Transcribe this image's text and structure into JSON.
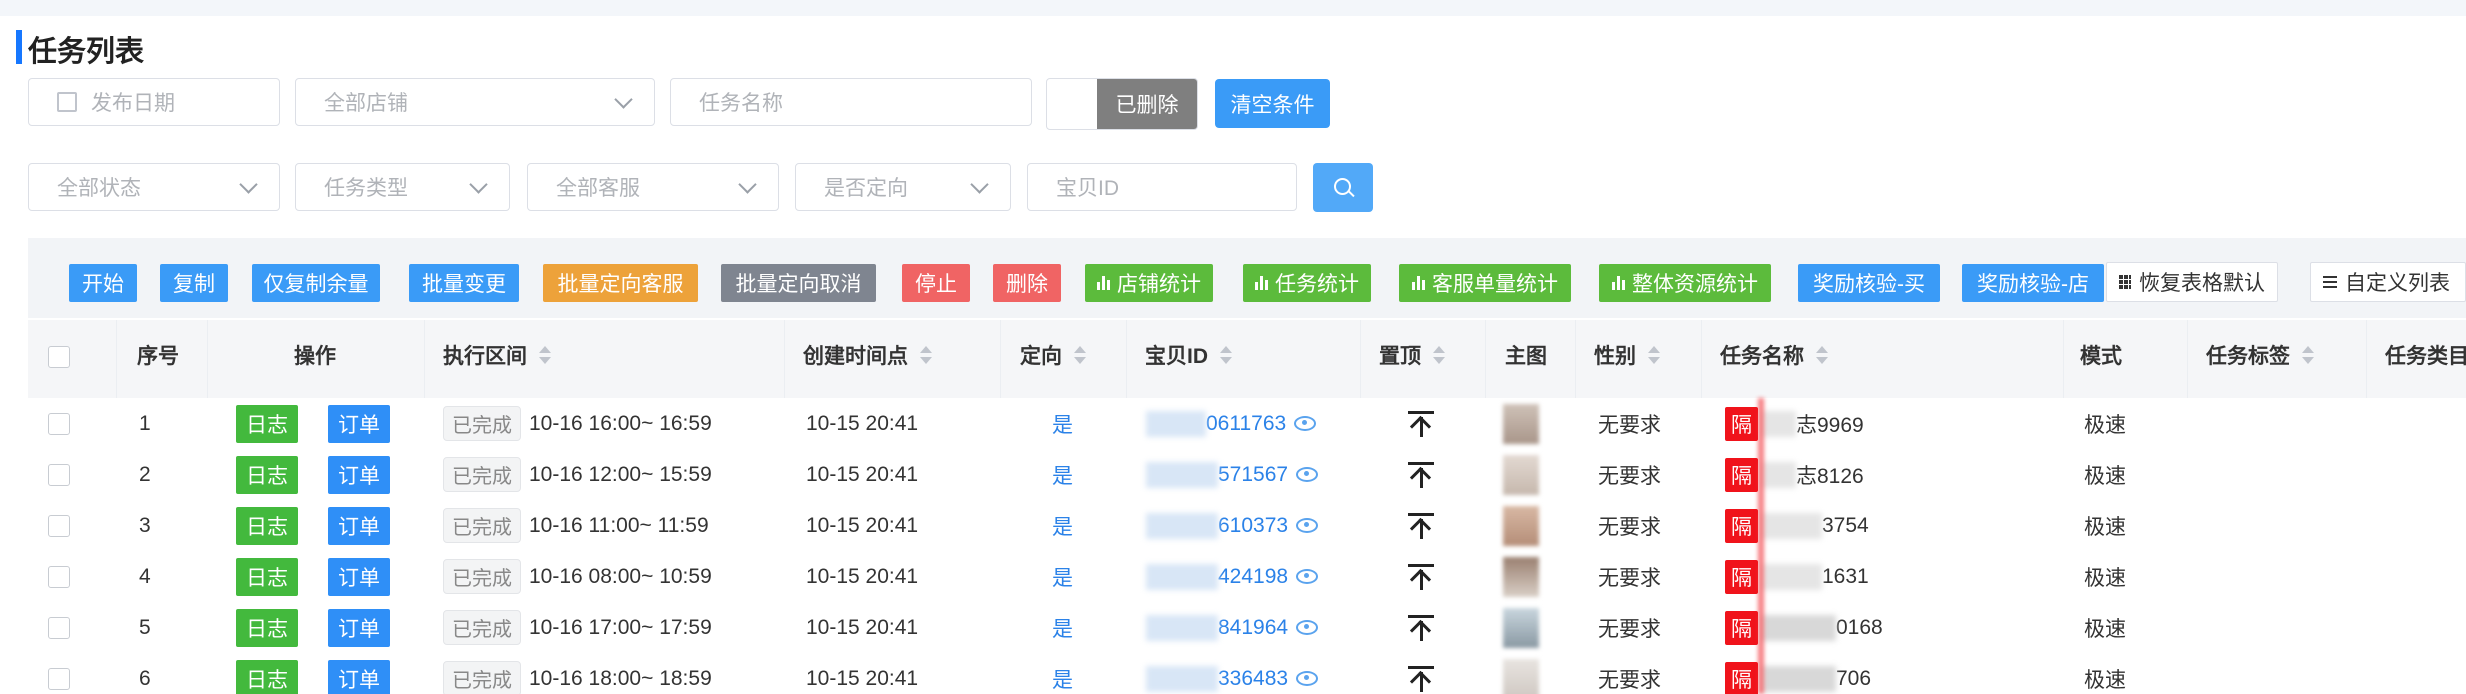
{
  "title": "任务列表",
  "filters": {
    "date_placeholder": "发布日期",
    "store_placeholder": "全部店铺",
    "task_name_placeholder": "任务名称",
    "deleted_label": "已删除",
    "clear_label": "清空条件",
    "status_placeholder": "全部状态",
    "task_type_placeholder": "任务类型",
    "cs_placeholder": "全部客服",
    "targeted_placeholder": "是否定向",
    "item_id_placeholder": "宝贝ID"
  },
  "toolbar": {
    "start": "开始",
    "copy": "复制",
    "copy_remain": "仅复制余量",
    "batch_change": "批量变更",
    "batch_assign_cs": "批量定向客服",
    "batch_cancel": "批量定向取消",
    "stop": "停止",
    "delete": "删除",
    "store_stats": "店铺统计",
    "task_stats": "任务统计",
    "cs_stats": "客服单量统计",
    "resource_stats": "整体资源统计",
    "reward_buy": "奖励核验-买",
    "reward_store": "奖励核验-店",
    "restore_default": "恢复表格默认",
    "custom_columns": "自定义列表"
  },
  "columns": {
    "index": "序号",
    "action": "操作",
    "exec_range": "执行区间",
    "created": "创建时间点",
    "targeted": "定向",
    "item_id": "宝贝ID",
    "pin": "置顶",
    "image": "主图",
    "gender": "性别",
    "task_name": "任务名称",
    "mode": "模式",
    "task_tag": "任务标签",
    "task_category": "任务类目"
  },
  "labels": {
    "log": "日志",
    "order": "订单",
    "completed": "已完成",
    "isolate": "隔"
  },
  "rows": [
    {
      "index": "1",
      "range": "10-16 16:00~ 16:59",
      "created": "10-15 20:41",
      "targeted": "是",
      "item_id_tail": "0611763",
      "gender": "无要求",
      "task_tail": "志9969",
      "mode": "极速"
    },
    {
      "index": "2",
      "range": "10-16 12:00~ 15:59",
      "created": "10-15 20:41",
      "targeted": "是",
      "item_id_tail": "571567",
      "gender": "无要求",
      "task_tail": "志8126",
      "mode": "极速"
    },
    {
      "index": "3",
      "range": "10-16 11:00~ 11:59",
      "created": "10-15 20:41",
      "targeted": "是",
      "item_id_tail": "610373",
      "gender": "无要求",
      "task_tail": "3754",
      "mode": "极速"
    },
    {
      "index": "4",
      "range": "10-16 08:00~ 10:59",
      "created": "10-15 20:41",
      "targeted": "是",
      "item_id_tail": "424198",
      "gender": "无要求",
      "task_tail": "1631",
      "mode": "极速"
    },
    {
      "index": "5",
      "range": "10-16 17:00~ 17:59",
      "created": "10-15 20:41",
      "targeted": "是",
      "item_id_tail": "841964",
      "gender": "无要求",
      "task_tail": "0168",
      "mode": "极速"
    },
    {
      "index": "6",
      "range": "10-16 18:00~ 18:59",
      "created": "10-15 20:41",
      "targeted": "是",
      "item_id_tail": "336483",
      "gender": "无要求",
      "task_tail": "706",
      "mode": "极速"
    }
  ],
  "colors": {
    "accent": "#1677ff",
    "blue": "#3a9bf7",
    "green": "#43b93d",
    "orange": "#eda23a",
    "gray": "#7f8590",
    "red": "#f06464",
    "isolate_red": "#f0131b"
  }
}
